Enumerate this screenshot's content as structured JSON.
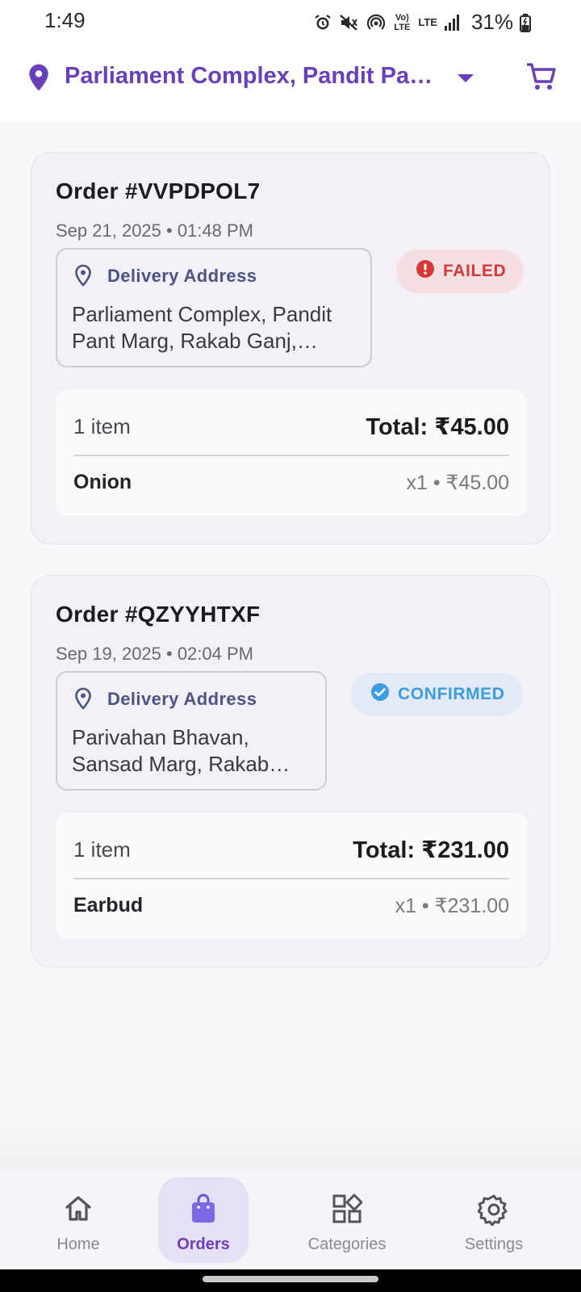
{
  "status_bar": {
    "time": "1:49",
    "battery": "31%",
    "network_label": "LTE",
    "volte_label": "Vo) LTE",
    "icons": [
      "alarm-icon",
      "mute-icon",
      "hotspot-icon",
      "volte-icon",
      "lte-icon",
      "signal-icon",
      "battery-icon"
    ]
  },
  "header": {
    "location": "Parliament Complex, Pandit Pant Marg, Rakab Ganj, Chanakya Puri",
    "dropdown_icon": "caret-down-icon",
    "cart_icon": "cart-icon",
    "accent_color": "#6a3fbc"
  },
  "orders": [
    {
      "title": "Order #VVPDPOL7",
      "date": "Sep 21, 2025 • 01:48 PM",
      "address_label": "Delivery Address",
      "address": "Parliament Complex, Pandit Pant Marg, Rakab Ganj, Chanakya Puri",
      "status": "FAILED",
      "status_color": "#d43a3a",
      "item_count": "1 item",
      "total": "Total: ₹45.00",
      "items": [
        {
          "name": "Onion",
          "qty_price": "x1 • ₹45.00"
        }
      ]
    },
    {
      "title": "Order #QZYYHTXF",
      "date": "Sep 19, 2025 • 02:04 PM",
      "address_label": "Delivery Address",
      "address": "Parivahan Bhavan, Sansad Marg, Rakab Ganj, New Delhi",
      "status": "CONFIRMED",
      "status_color": "#3b9be3",
      "item_count": "1 item",
      "total": "Total: ₹231.00",
      "items": [
        {
          "name": "Earbud",
          "qty_price": "x1 • ₹231.00"
        }
      ]
    }
  ],
  "nav": {
    "items": [
      {
        "label": "Home",
        "icon": "home-icon",
        "active": false
      },
      {
        "label": "Orders",
        "icon": "shopping-bag-icon",
        "active": true
      },
      {
        "label": "Categories",
        "icon": "categories-icon",
        "active": false
      },
      {
        "label": "Settings",
        "icon": "gear-icon",
        "active": false
      }
    ]
  }
}
